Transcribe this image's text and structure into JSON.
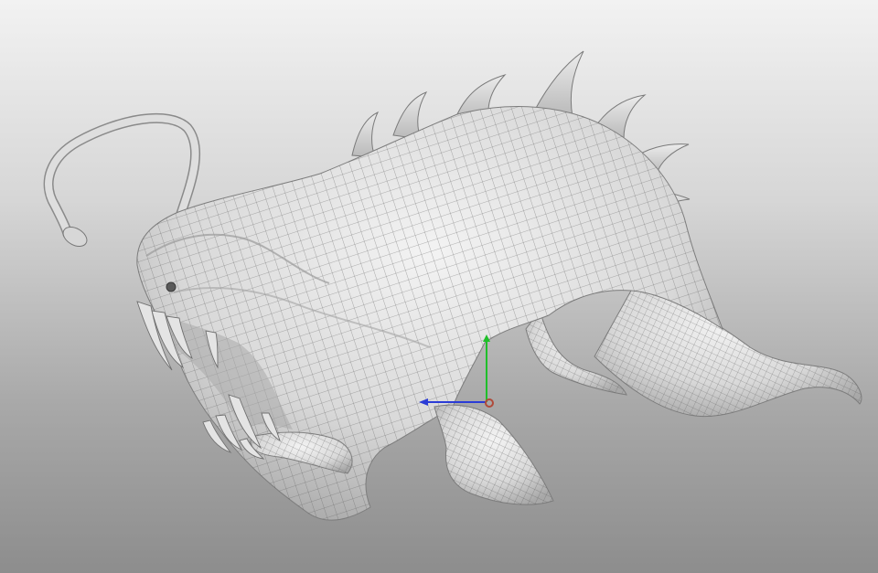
{
  "viewport": {
    "view": "perspective",
    "background_top": "#f2f2f2",
    "background_bottom": "#8d8d8d",
    "shading": "wireframe-on-shaded"
  },
  "model": {
    "kind": "anglerfish creature sculpt",
    "surface_color": "#dcdcdc",
    "wire_color": "#555555"
  },
  "gizmo": {
    "type": "move-manipulator",
    "x_axis_color": "#2b3cd6",
    "y_axis_color": "#1fbf2a",
    "pivot_color": "#b04a3a"
  }
}
